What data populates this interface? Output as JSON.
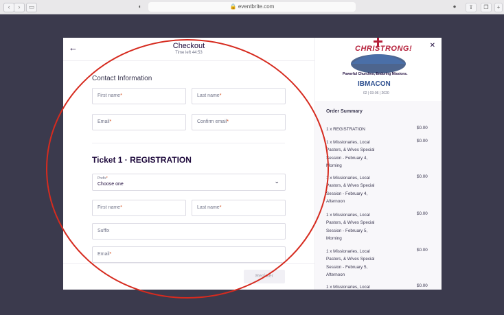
{
  "browser": {
    "url": "eventbrite.com"
  },
  "checkout": {
    "title": "Checkout",
    "timer": "Time left 44:53",
    "contact_section": "Contact Information",
    "fields": {
      "first_name": "First name",
      "last_name": "Last name",
      "email": "Email",
      "confirm_email": "Confirm email"
    },
    "required_mark": "*",
    "ticket_title": "Ticket 1 · REGISTRATION",
    "prefix_label": "Prefix",
    "prefix_value": "Choose one",
    "ticket_fields": {
      "first_name": "First name",
      "last_name": "Last name",
      "suffix": "Suffix",
      "email": "Email"
    },
    "register_button": "Register"
  },
  "event_logo": {
    "main": "CHRISTRONG!",
    "tagline": "Powerful Churches, Enduring Missions.",
    "org": "IBMACON",
    "date": "02 | 03-06 | 2020"
  },
  "order_summary": {
    "title": "Order Summary",
    "items": [
      {
        "label": "1 x REGISTRATION",
        "price": "$0.00"
      },
      {
        "label": "1 x Missionaries, Local Pastors, & Wives Special Session - February 4, Morning",
        "price": "$0.00"
      },
      {
        "label": "1 x Missionaries, Local Pastors, & Wives Special Session - February 4, Afternoon",
        "price": "$0.00"
      },
      {
        "label": "1 x Missionaries, Local Pastors, & Wives Special Session - February 5, Morning",
        "price": "$0.00"
      },
      {
        "label": "1 x Missionaries, Local Pastors, & Wives Special Session - February 5, Afternoon",
        "price": "$0.00"
      },
      {
        "label": "1 x Missionaries, Local",
        "price": "$0.00"
      }
    ]
  },
  "colors": {
    "annotation": "#d62b1f",
    "required": "#d1410c",
    "backdrop": "#3b3a4d"
  },
  "icons": [
    "back-arrow-icon",
    "close-icon",
    "chevron-down-icon",
    "sidebar-icon",
    "reload-icon",
    "share-icon"
  ]
}
